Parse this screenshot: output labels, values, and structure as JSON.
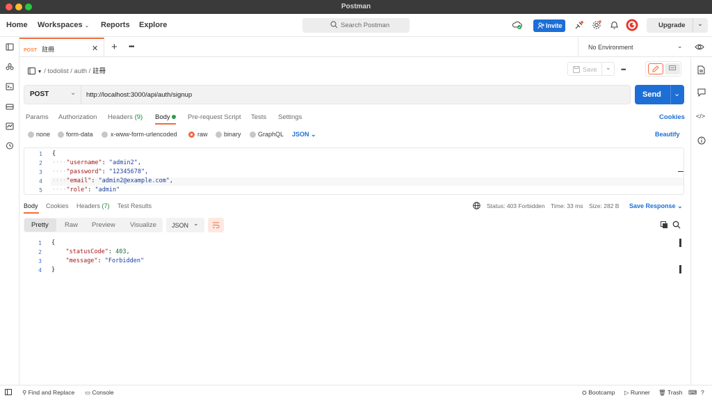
{
  "window": {
    "title": "Postman"
  },
  "header": {
    "nav": [
      "Home",
      "Workspaces",
      "Reports",
      "Explore"
    ],
    "search_placeholder": "Search Postman",
    "invite_label": "Invite",
    "upgrade_label": "Upgrade"
  },
  "tabs": {
    "active": {
      "method": "POST",
      "name": "註冊"
    },
    "environment": "No Environment"
  },
  "breadcrumb": {
    "parts": [
      "todolist",
      "auth",
      "註冊"
    ]
  },
  "save_label": "Save",
  "request": {
    "method": "POST",
    "url": "http://localhost:3000/api/auth/signup",
    "send_label": "Send"
  },
  "request_tabs": {
    "items": [
      "Params",
      "Authorization",
      "Headers",
      "Body",
      "Pre-request Script",
      "Tests",
      "Settings"
    ],
    "headers_count": "(9)",
    "cookies_label": "Cookies"
  },
  "body_types": {
    "items": [
      "none",
      "form-data",
      "x-www-form-urlencoded",
      "raw",
      "binary",
      "GraphQL"
    ],
    "selected": "raw",
    "format": "JSON",
    "beautify_label": "Beautify"
  },
  "request_body": {
    "line_numbers": [
      "1",
      "2",
      "3",
      "4",
      "5"
    ],
    "lines": [
      {
        "text": "{"
      },
      {
        "key": "\"username\"",
        "value": "\"admin2\","
      },
      {
        "key": "\"password\"",
        "value": "\"12345678\","
      },
      {
        "key": "\"email\"",
        "value": "\"admin2@example.com\","
      },
      {
        "key": "\"role\"",
        "value": "\"admin\""
      }
    ]
  },
  "response": {
    "tabs": [
      "Body",
      "Cookies",
      "Headers",
      "Test Results"
    ],
    "headers_count": "(7)",
    "status": "Status: 403 Forbidden",
    "time": "Time: 33 ms",
    "size": "Size: 282 B",
    "save_label": "Save Response",
    "view_modes": [
      "Pretty",
      "Raw",
      "Preview",
      "Visualize"
    ],
    "format": "JSON",
    "line_numbers": [
      "1",
      "2",
      "3",
      "4"
    ],
    "lines": [
      {
        "text": "{"
      },
      {
        "key": "\"statusCode\"",
        "value": "403,"
      },
      {
        "key": "\"message\"",
        "value": "\"Forbidden\""
      },
      {
        "text": "}"
      }
    ]
  },
  "footer": {
    "find_replace": "Find and Replace",
    "console": "Console",
    "bootcamp": "Bootcamp",
    "runner": "Runner",
    "trash": "Trash"
  },
  "colors": {
    "accent": "#f26b3a",
    "send_blue": "#1d6fd6",
    "status_error": "#e23c2f"
  }
}
